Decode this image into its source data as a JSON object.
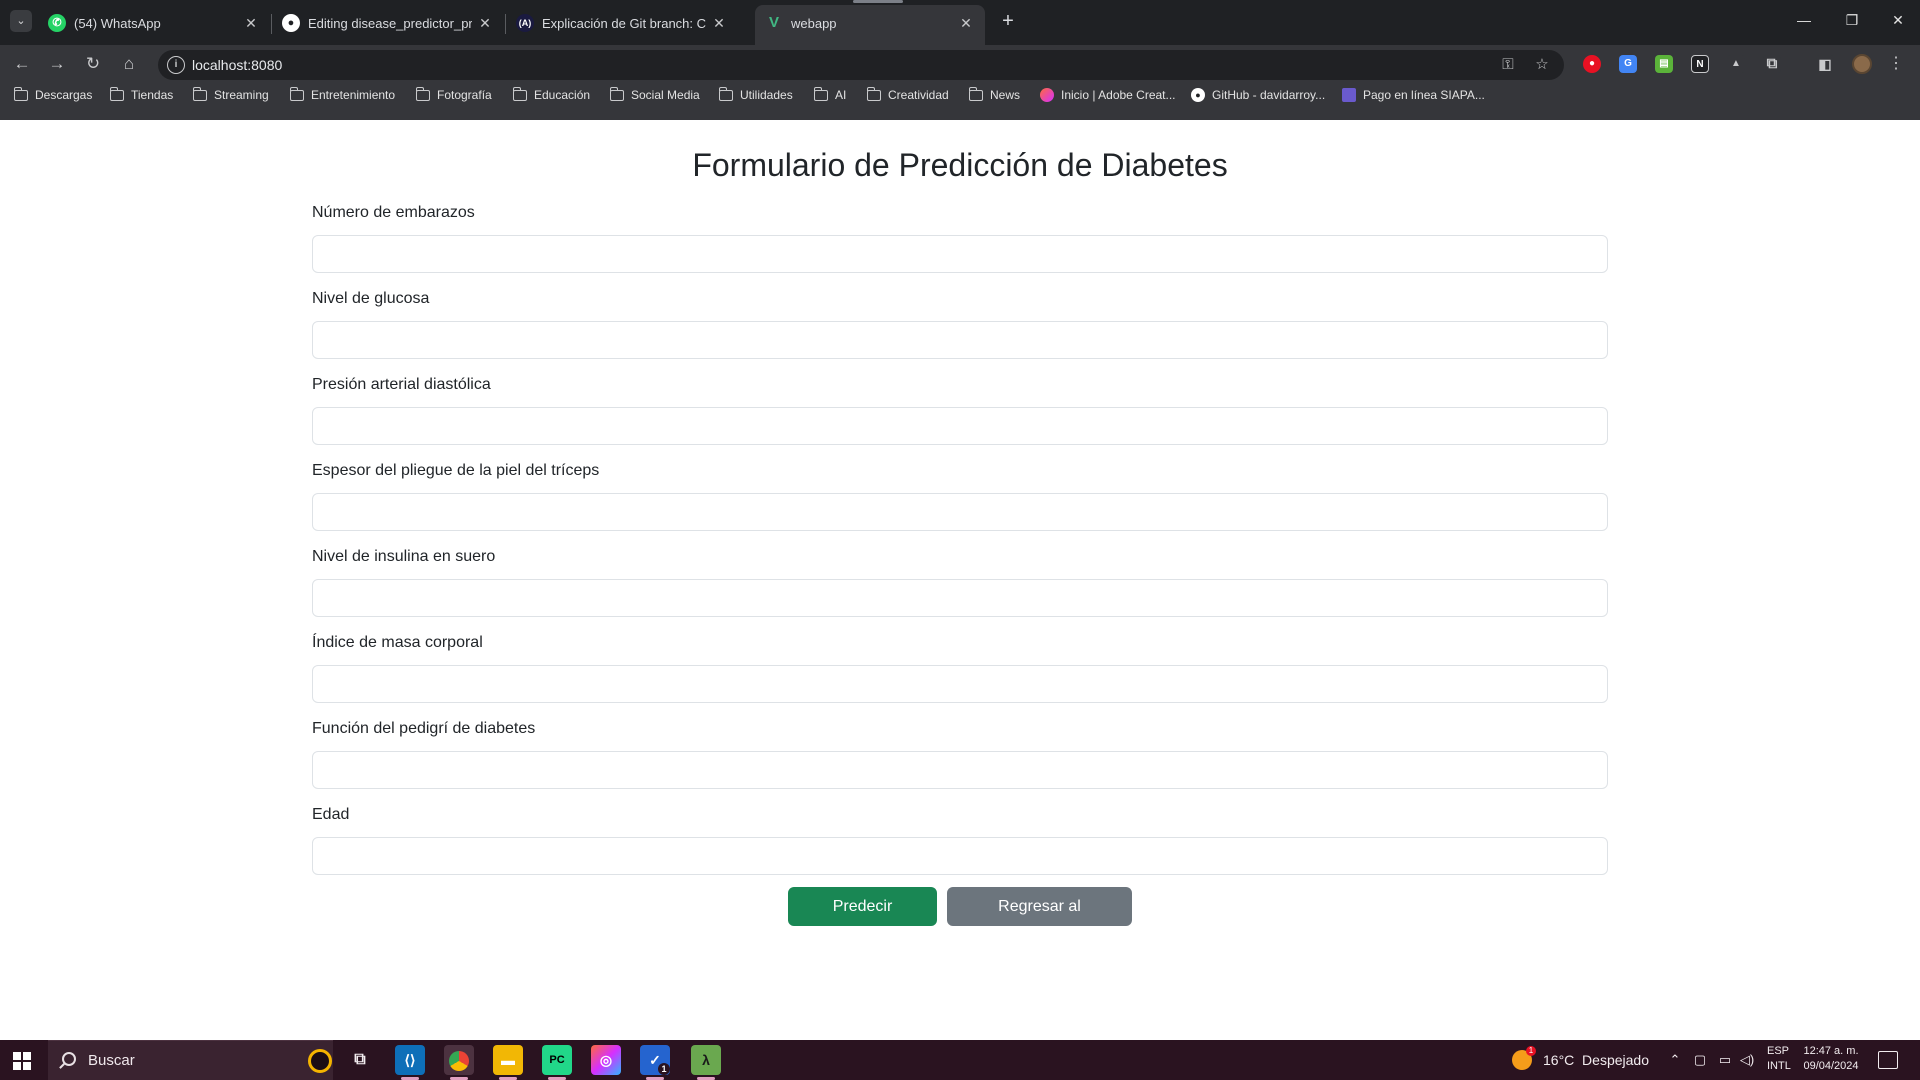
{
  "browser": {
    "tabs": [
      {
        "title": "(54) WhatsApp",
        "icon": "whatsapp-icon",
        "color": "#25d366"
      },
      {
        "title": "Editing disease_predictor_proje",
        "icon": "github-icon",
        "color": "#ffffff"
      },
      {
        "title": "Explicación de Git branch: Cóm",
        "icon": "alura-icon",
        "color": "#1a1a40"
      },
      {
        "title": "webapp",
        "icon": "vue-icon",
        "color": "#41b883"
      }
    ],
    "url": "localhost:8080",
    "bookmarks": [
      "Descargas",
      "Tiendas",
      "Streaming",
      "Entretenimiento",
      "Fotografía",
      "Educación",
      "Social Media",
      "Utilidades",
      "AI",
      "Creatividad",
      "News",
      "Inicio | Adobe Creat...",
      "GitHub - davidarroy...",
      "Pago en línea SIAPA..."
    ]
  },
  "form": {
    "title": "Formulario de Predicción de Diabetes",
    "fields": [
      {
        "label": "Número de embarazos",
        "value": ""
      },
      {
        "label": "Nivel de glucosa",
        "value": ""
      },
      {
        "label": "Presión arterial diastólica",
        "value": ""
      },
      {
        "label": "Espesor del pliegue de la piel del tríceps",
        "value": ""
      },
      {
        "label": "Nivel de insulina en suero",
        "value": ""
      },
      {
        "label": "Índice de masa corporal",
        "value": ""
      },
      {
        "label": "Función del pedigrí de diabetes",
        "value": ""
      },
      {
        "label": "Edad",
        "value": ""
      }
    ],
    "predict_button": "Predecir Diabetes",
    "back_button": "Regresar al Dashboard",
    "colors": {
      "success": "#198754",
      "secondary": "#6c757d"
    }
  },
  "taskbar": {
    "search_placeholder": "Buscar",
    "weather": "16°C  Despejado",
    "weather_badge": "1",
    "lang_line1": "ESP",
    "lang_line2": "INTL",
    "time": "12:47 a. m.",
    "date": "09/04/2024",
    "todo_badge": "1"
  }
}
